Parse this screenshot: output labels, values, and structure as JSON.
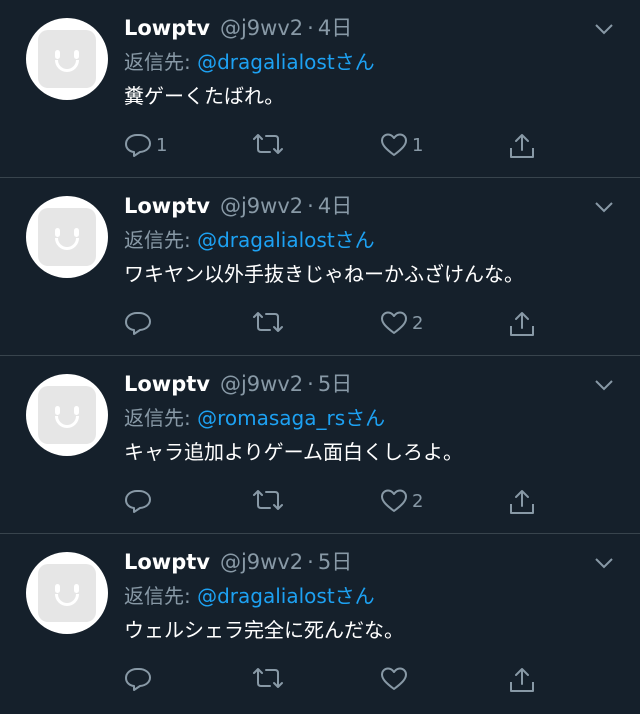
{
  "colors": {
    "background": "#15202b",
    "accent": "#1da1f2",
    "muted": "#8899a6",
    "divider": "#38444d"
  },
  "tweets": [
    {
      "name": "Lowptv",
      "handle": "@j9wv2",
      "separator": "·",
      "time": "4日",
      "reply_label": "返信先: ",
      "reply_to": "@dragalialost",
      "reply_suffix": "さん",
      "text": "糞ゲーくたばれ。",
      "reply_count": "1",
      "retweet_count": "",
      "like_count": "1"
    },
    {
      "name": "Lowptv",
      "handle": "@j9wv2",
      "separator": "·",
      "time": "4日",
      "reply_label": "返信先: ",
      "reply_to": "@dragalialost",
      "reply_suffix": "さん",
      "text": "ワキヤン以外手抜きじゃねーかふざけんな。",
      "reply_count": "",
      "retweet_count": "",
      "like_count": "2"
    },
    {
      "name": "Lowptv",
      "handle": "@j9wv2",
      "separator": "·",
      "time": "5日",
      "reply_label": "返信先: ",
      "reply_to": "@romasaga_rs",
      "reply_suffix": "さん",
      "text": "キャラ追加よりゲーム面白くしろよ。",
      "reply_count": "",
      "retweet_count": "",
      "like_count": "2"
    },
    {
      "name": "Lowptv",
      "handle": "@j9wv2",
      "separator": "·",
      "time": "5日",
      "reply_label": "返信先: ",
      "reply_to": "@dragalialost",
      "reply_suffix": "さん",
      "text": "ウェルシェラ完全に死んだな。",
      "reply_count": "",
      "retweet_count": "",
      "like_count": ""
    }
  ],
  "icons": [
    "avatar",
    "chevron-down-icon",
    "reply-icon",
    "retweet-icon",
    "like-icon",
    "share-icon"
  ]
}
